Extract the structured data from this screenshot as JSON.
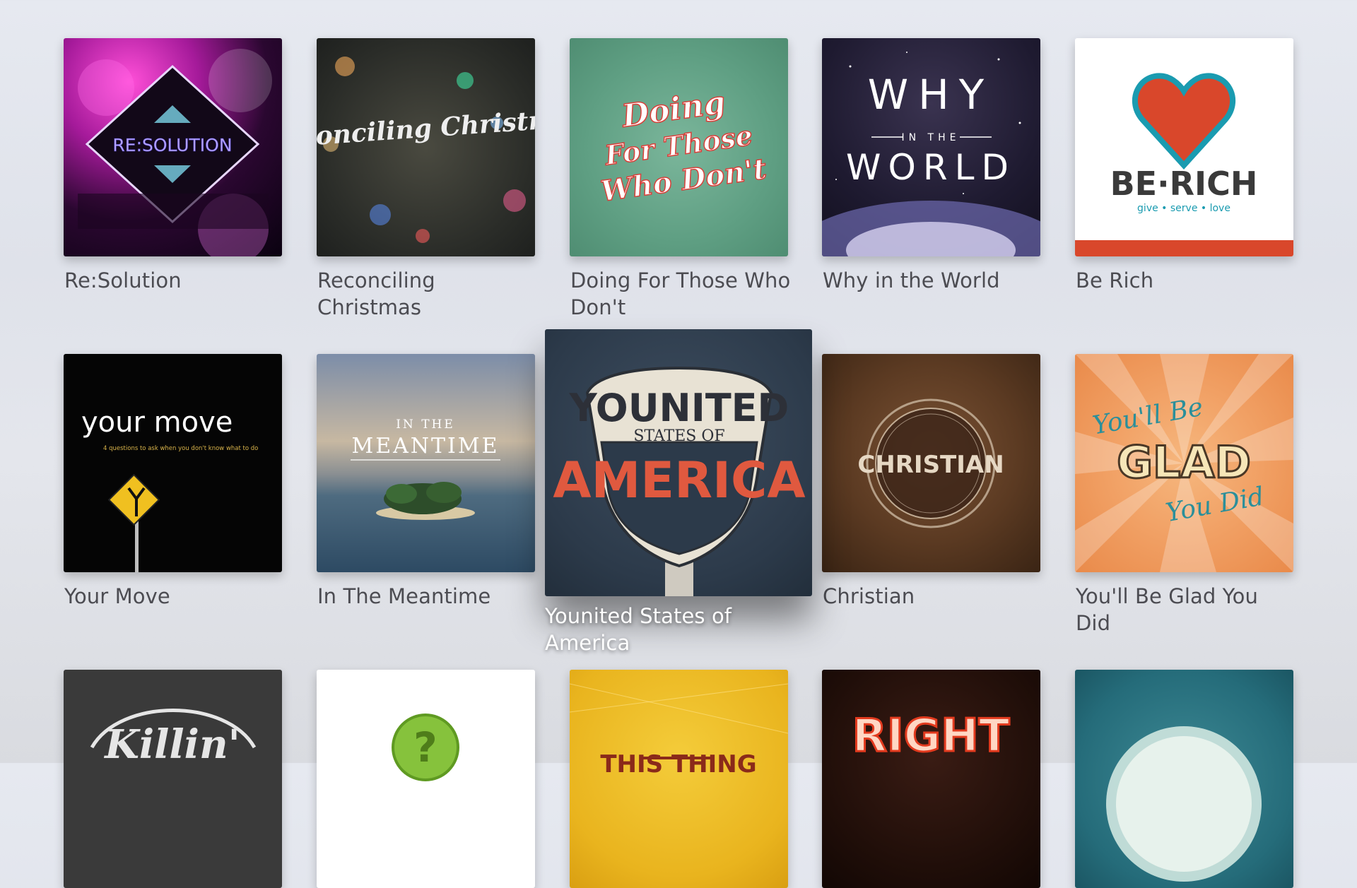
{
  "shelf": {
    "items": [
      {
        "title": "Re:Solution",
        "art_text": "RE:SOLUTION"
      },
      {
        "title": "Reconciling Christmas",
        "art_text": "Reconciling Christmas"
      },
      {
        "title": "Doing For Those Who Don't",
        "art_text": "Doing For Those Who Don't"
      },
      {
        "title": "Why in the World",
        "art_text": "WHY IN THE WORLD"
      },
      {
        "title": "Be Rich",
        "art_text": "BE·RICH",
        "art_subtext": "give • serve • love"
      },
      {
        "title": "Your Move",
        "art_text": "your move",
        "art_subtext": "4 questions to ask when you don't know what to do"
      },
      {
        "title": "In The Meantime",
        "art_text": "IN THE MEANTIME"
      },
      {
        "title": "Younited States of America",
        "art_text": "YOUNITED STATES OF AMERICA",
        "focused": true
      },
      {
        "title": "Christian",
        "art_text": "CHRISTIAN"
      },
      {
        "title": "You'll Be Glad You Did",
        "art_text": "You'll Be GLAD You Did"
      },
      {
        "title": "",
        "art_text": "Killin'"
      },
      {
        "title": "",
        "art_text": "?"
      },
      {
        "title": "",
        "art_text": "THIS THING"
      },
      {
        "title": "",
        "art_text": "RIGHT"
      },
      {
        "title": "",
        "art_text": ""
      }
    ]
  },
  "colors": {
    "caption": "#4c4c52",
    "focused_caption": "#ffffff",
    "berich_red": "#d9472b",
    "berich_teal": "#1a9bb0"
  }
}
